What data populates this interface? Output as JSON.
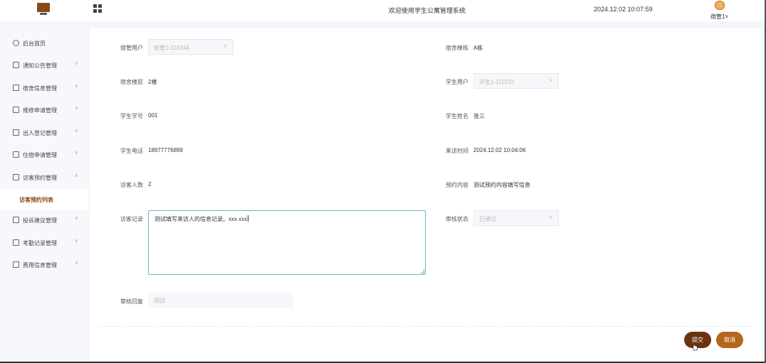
{
  "header": {
    "welcome": "欢迎使用学生公寓管理系统",
    "datetime": "2024.12.02 10:07:59",
    "user": "宿管1",
    "user_arrow": "˅"
  },
  "sidebar": {
    "items": [
      {
        "label": "后台首页",
        "icon": "clock-icon",
        "arrow": ""
      },
      {
        "label": "通知公告管理",
        "icon": "list-icon",
        "arrow": "˅"
      },
      {
        "label": "宿舍信息管理",
        "icon": "list-icon",
        "arrow": "˅"
      },
      {
        "label": "维修申请管理",
        "icon": "list-icon",
        "arrow": "˅"
      },
      {
        "label": "出入登记管理",
        "icon": "list-icon",
        "arrow": "˅"
      },
      {
        "label": "住宿申请管理",
        "icon": "list-icon",
        "arrow": "˅"
      },
      {
        "label": "访客预约管理",
        "icon": "list-icon",
        "arrow": "˄"
      },
      {
        "label": "投诉建议管理",
        "icon": "list-icon",
        "arrow": "˅"
      },
      {
        "label": "考勤记录管理",
        "icon": "list-icon",
        "arrow": "˅"
      },
      {
        "label": "费用信息管理",
        "icon": "list-icon",
        "arrow": "˅"
      }
    ],
    "active_sub": "访客预约列表"
  },
  "form": {
    "dorm_user_label": "宿管用户",
    "dorm_user_value": "宿管1-223344",
    "building_label": "宿舍楼栋",
    "building_value": "A栋",
    "floor_label": "宿舍楼层",
    "floor_value": "2楼",
    "student_user_label": "学生用户",
    "student_user_value": "学生1-112233",
    "student_no_label": "学生学号",
    "student_no_value": "001",
    "student_name_label": "学生姓名",
    "student_name_value": "张三",
    "phone_label": "学生电话",
    "phone_value": "18977776899",
    "visit_time_label": "来访时间",
    "visit_time_value": "2024.12.02 10:04:06",
    "visitor_count_label": "访客人数",
    "visitor_count_value": "2",
    "content_label": "预约内容",
    "content_value": "测试预约内容填写信息",
    "record_label": "访客记录",
    "record_value": "测试填写来访人的信息记录。xxx xxx",
    "status_label": "审核状态",
    "status_value": "已通过",
    "reply_label": "审核回复",
    "reply_value": "测试",
    "select_arrow": "˅"
  },
  "buttons": {
    "submit": "提交",
    "cancel": "取消"
  },
  "colors": {
    "brand_dark": "#6b3410",
    "brand_light": "#b4651e",
    "textarea_focus": "#6cb6c9"
  }
}
